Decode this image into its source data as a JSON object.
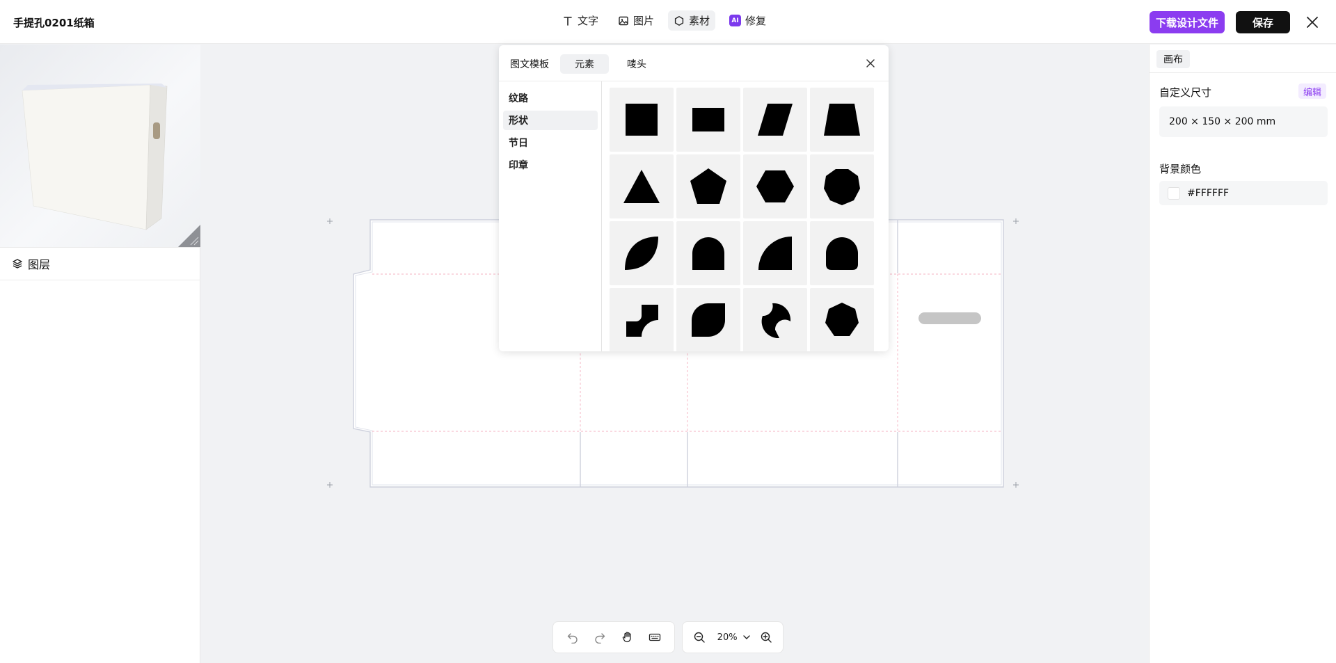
{
  "header": {
    "doc_title": "手提孔0201纸箱",
    "tools": [
      {
        "label": "文字",
        "icon": "text-icon"
      },
      {
        "label": "图片",
        "icon": "image-icon"
      },
      {
        "label": "素材",
        "icon": "material-icon",
        "active": true
      },
      {
        "label": "修复",
        "icon": "ai-badge",
        "badge": "AI"
      }
    ],
    "download_label": "下载设计文件",
    "save_label": "保存"
  },
  "left_panel": {
    "layers_label": "图层"
  },
  "material_popup": {
    "tabs": [
      "图文模板",
      "元素",
      "唛头"
    ],
    "active_tab": "元素",
    "categories": [
      "纹路",
      "形状",
      "节日",
      "印章"
    ],
    "active_category": "形状",
    "shapes": [
      "square",
      "rectangle",
      "parallelogram",
      "trapezoid",
      "triangle",
      "pentagon",
      "hexagon",
      "octagon",
      "leaf",
      "arch",
      "quarter-circle",
      "rounded-arch",
      "notched-square",
      "teardrop",
      "crescent",
      "heptagon"
    ]
  },
  "right_panel": {
    "tab": "画布",
    "size_label": "自定义尺寸",
    "edit_label": "编辑",
    "size_value": "200 × 150 × 200 mm",
    "bg_label": "背景颜色",
    "bg_value": "#FFFFFF"
  },
  "bottom_toolbar": {
    "zoom": "20%"
  },
  "colors": {
    "accent": "#8b3cf0",
    "dark_button": "#111111",
    "canvas_bg": "#f1f2f4",
    "dieline": "#c9ccd8",
    "fold_line": "#f4b0c0"
  }
}
